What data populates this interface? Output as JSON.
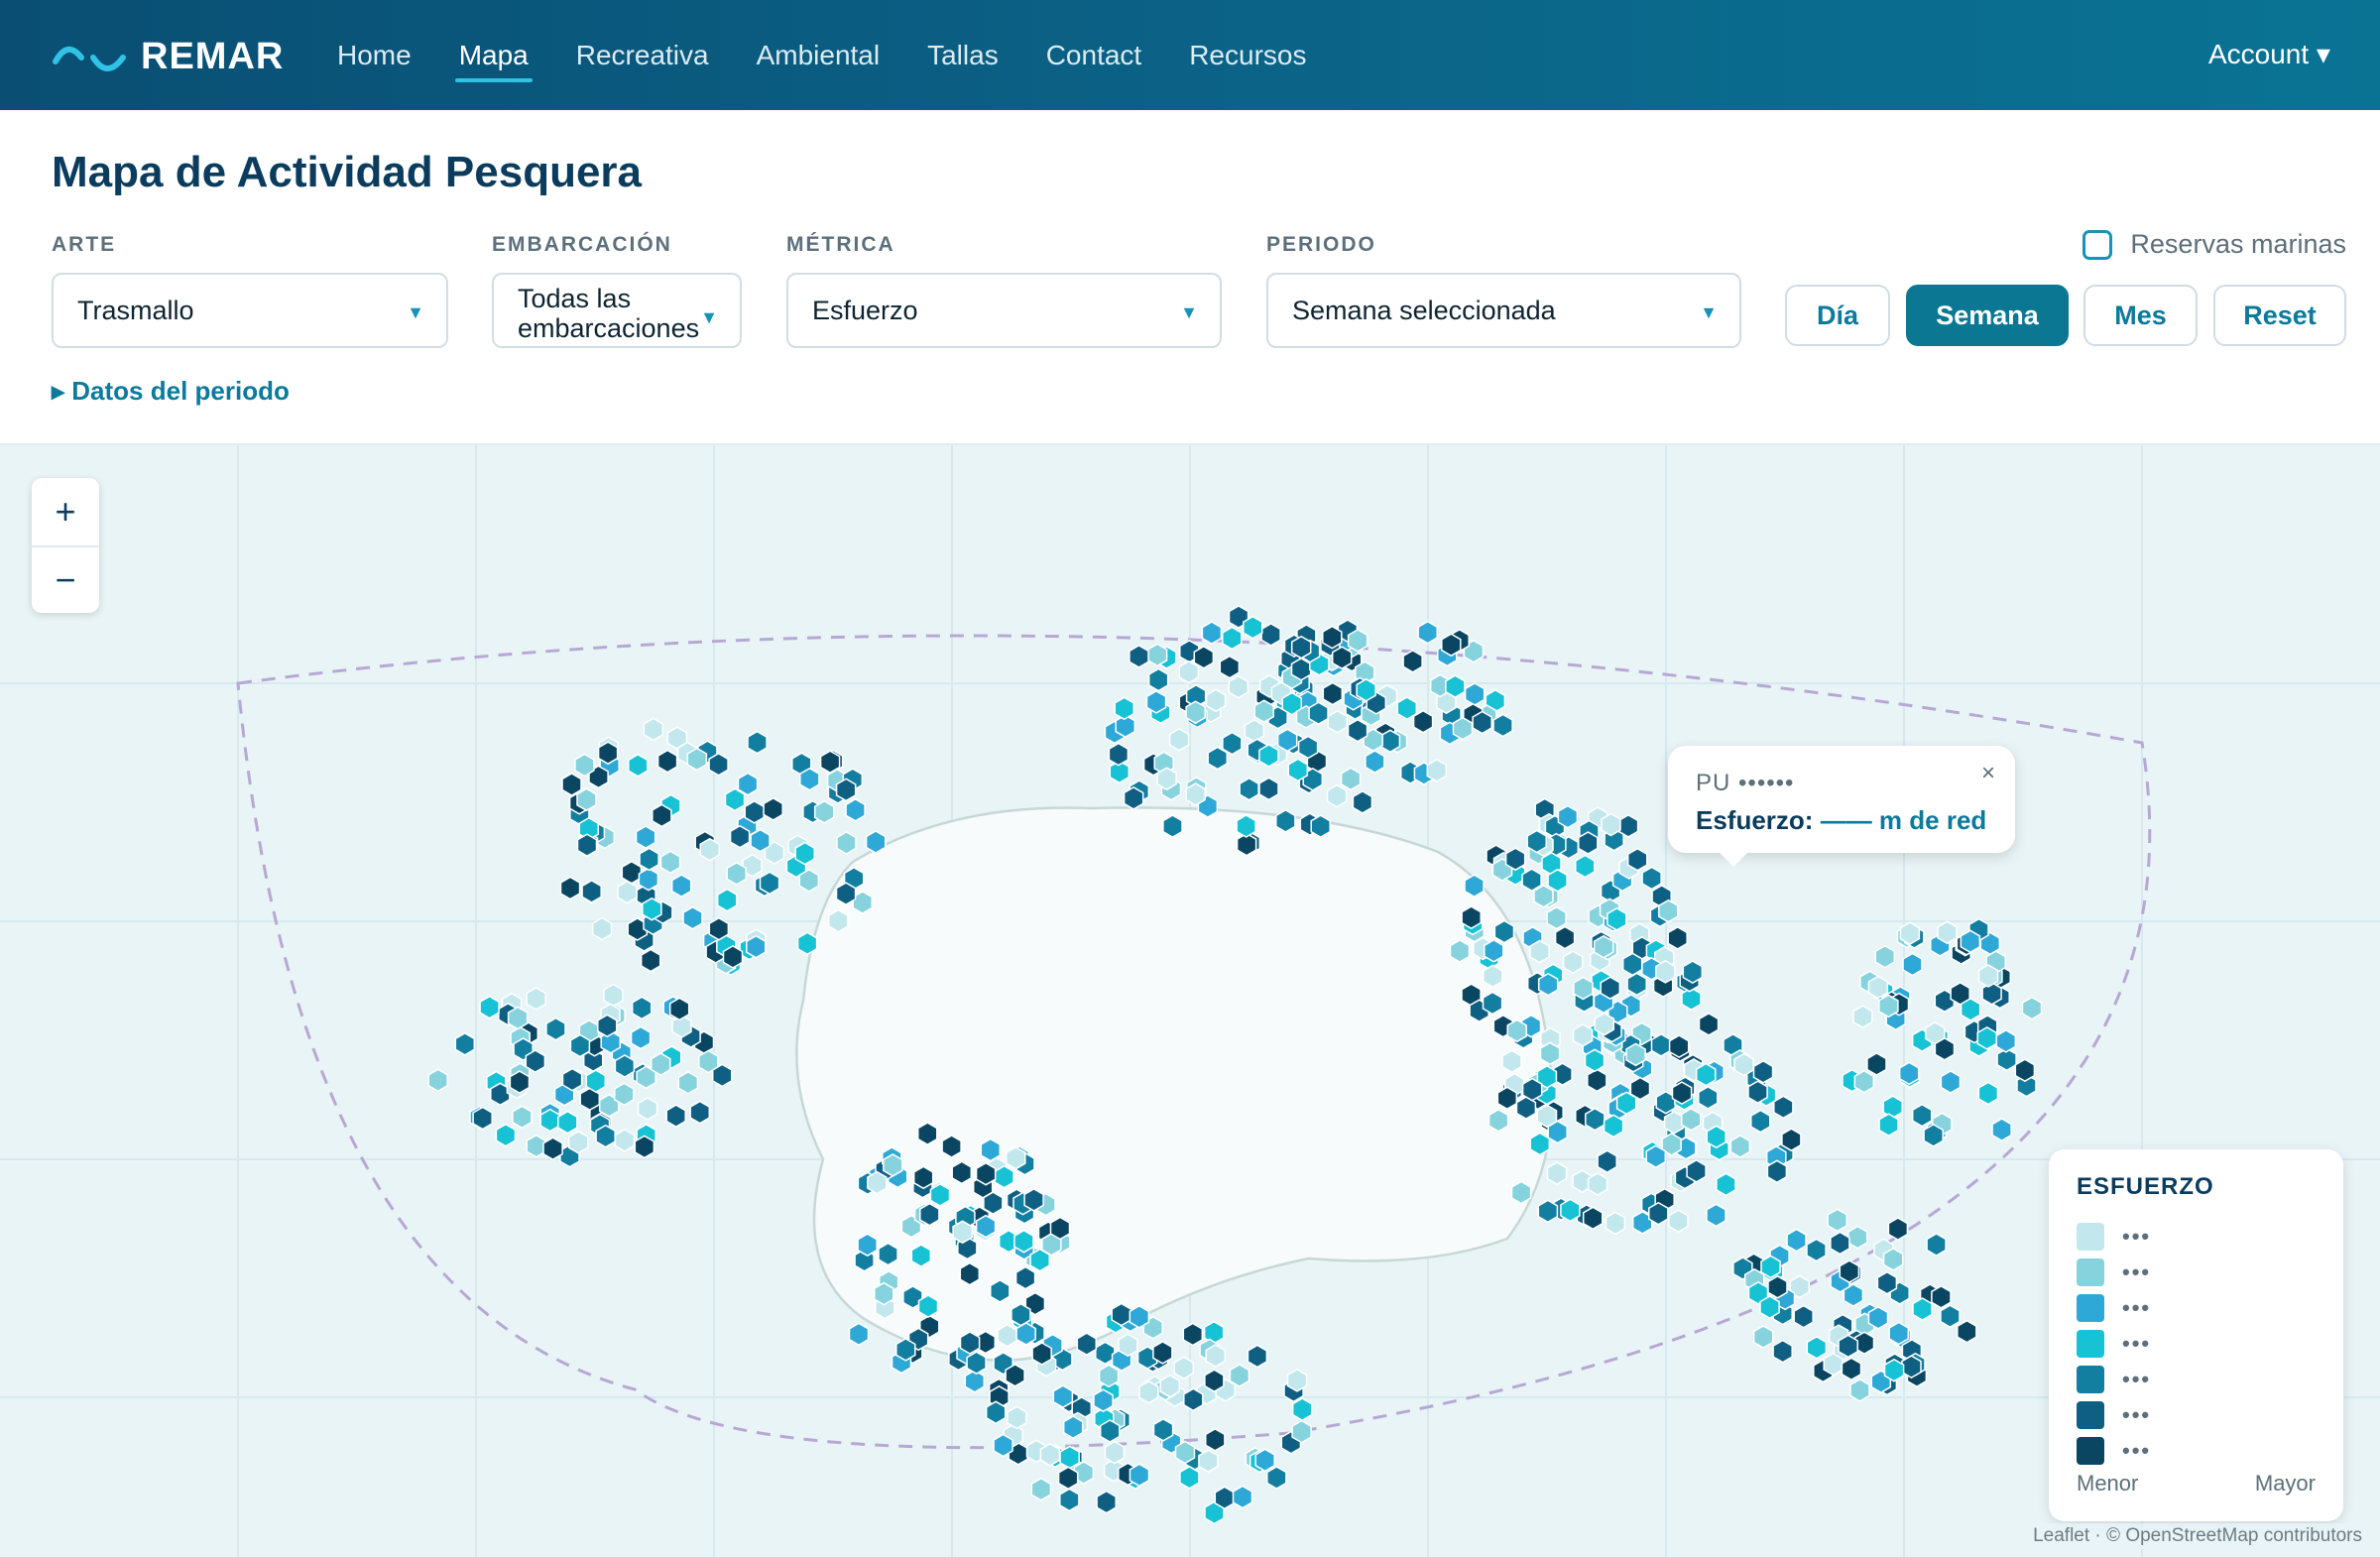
{
  "app": {
    "name": "REMAR"
  },
  "nav": {
    "links": [
      "Home",
      "Mapa",
      "Recreativa",
      "Ambiental",
      "Tallas",
      "Contact",
      "Recursos"
    ],
    "active": "Mapa",
    "account": "Account ▾"
  },
  "page": {
    "title": "Mapa de Actividad Pesquera"
  },
  "filters": {
    "arte": {
      "label": "ARTE",
      "value": "Trasmallo"
    },
    "embarcacion": {
      "label": "EMBARCACIÓN",
      "value": "Todas las embarcaciones"
    },
    "metrica": {
      "label": "MÉTRICA",
      "value": "Esfuerzo"
    },
    "periodo": {
      "label": "PERIODO",
      "value": "Semana seleccionada"
    },
    "reservas": {
      "label": "Reservas marinas",
      "checked": false
    },
    "buttons": [
      "Día",
      "Semana",
      "Mes",
      "Reset"
    ],
    "active_button": "Semana",
    "details_link": "▸ Datos del periodo"
  },
  "map": {
    "zoom_in": "+",
    "zoom_out": "−",
    "popup": {
      "title": "PU ••••••",
      "label": "Esfuerzo:",
      "value": "—— m de red",
      "close": "×"
    },
    "legend": {
      "title": "ESFUERZO",
      "colors": [
        "#c2e8ee",
        "#86d3de",
        "#2ea8d6",
        "#16c2d4",
        "#127ea0",
        "#0f5f82",
        "#0a4662"
      ],
      "row_label": "•••",
      "min_label": "Menor",
      "max_label": "Mayor"
    },
    "attribution": "Leaflet · © OpenStreetMap contributors"
  },
  "colors": {
    "nav_start": "#0a4e73",
    "accent": "#0b7793",
    "active_underline": "#2fc3e6"
  }
}
